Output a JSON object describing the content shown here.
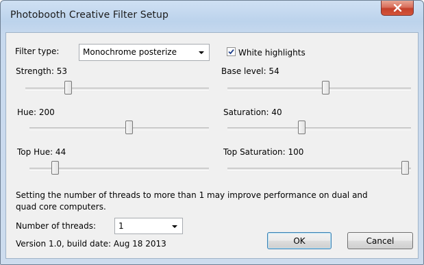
{
  "window": {
    "title": "Photobooth Creative Filter Setup",
    "close_label": "X"
  },
  "filter": {
    "type_label": "Filter type:",
    "type_value": "Monochrome posterize",
    "white_highlights_label": "White highlights",
    "white_highlights_checked": true
  },
  "sliders": {
    "strength": {
      "label": "Strength: 53",
      "value": 53
    },
    "base_level": {
      "label": "Base level: 54",
      "value": 54
    },
    "hue": {
      "label": "Hue: 200",
      "value": 200
    },
    "saturation": {
      "label": "Saturation: 40",
      "value": 40
    },
    "top_hue": {
      "label": "Top Hue: 44",
      "value": 44
    },
    "top_saturation": {
      "label": "Top Saturation: 100",
      "value": 100
    }
  },
  "threads": {
    "note_line1": "Setting the number of threads to more than 1 may improve performance on dual and",
    "note_line2": "quad core computers.",
    "label": "Number of threads:",
    "value": "1"
  },
  "version": "Version 1.0, build date: Aug 18 2013",
  "buttons": {
    "ok": "OK",
    "cancel": "Cancel"
  }
}
